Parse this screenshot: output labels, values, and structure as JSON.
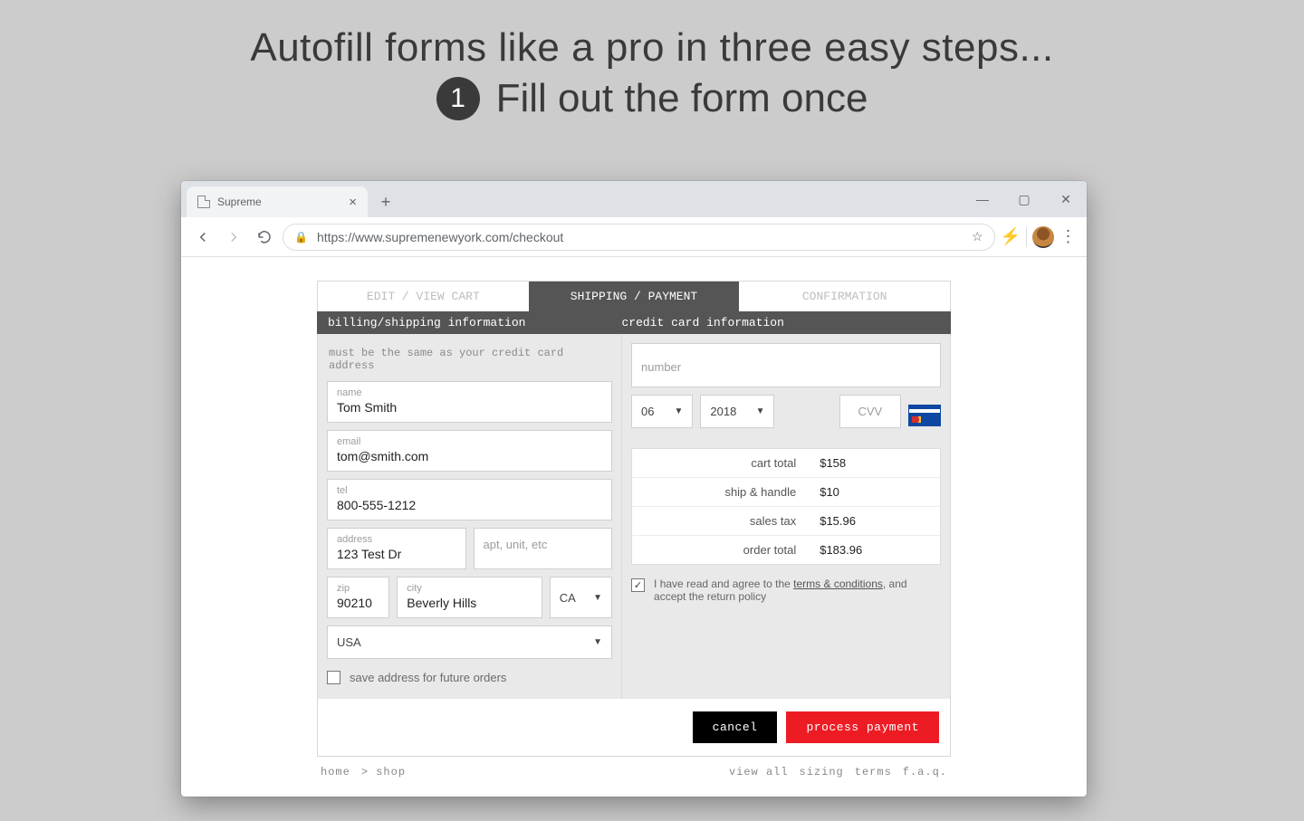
{
  "promo": {
    "line1": "Autofill forms like a pro in three easy steps...",
    "badge": "1",
    "line2": "Fill out the form once"
  },
  "browser": {
    "tab_title": "Supreme",
    "url": "https://www.supremenewyork.com/checkout"
  },
  "steps": {
    "edit": "EDIT / VIEW CART",
    "shipping": "SHIPPING / PAYMENT",
    "confirm": "CONFIRMATION"
  },
  "section_headers": {
    "billing": "billing/shipping information",
    "credit": "credit card information"
  },
  "hint": "must be the same as your credit card address",
  "fields": {
    "name_label": "name",
    "name_value": "Tom Smith",
    "email_label": "email",
    "email_value": "tom@smith.com",
    "tel_label": "tel",
    "tel_value": "800-555-1212",
    "address_label": "address",
    "address_value": "123 Test Dr",
    "apt_placeholder": "apt, unit, etc",
    "zip_label": "zip",
    "zip_value": "90210",
    "city_label": "city",
    "city_value": "Beverly Hills",
    "state_value": "CA",
    "country_value": "USA",
    "save_label": "save address for future orders"
  },
  "card": {
    "number_placeholder": "number",
    "month": "06",
    "year": "2018",
    "cvv_placeholder": "CVV"
  },
  "totals": [
    {
      "label": "cart total",
      "value": "$158"
    },
    {
      "label": "ship & handle",
      "value": "$10"
    },
    {
      "label": "sales tax",
      "value": "$15.96"
    },
    {
      "label": "order total",
      "value": "$183.96"
    }
  ],
  "terms": {
    "prefix": "I have read and agree to the ",
    "link": "terms & conditions",
    "suffix": ", and accept the return policy"
  },
  "buttons": {
    "cancel": "cancel",
    "process": "process payment"
  },
  "footer": {
    "home": "home",
    "shop": "> shop",
    "viewall": "view all",
    "sizing": "sizing",
    "terms": "terms",
    "faq": "f.a.q."
  }
}
